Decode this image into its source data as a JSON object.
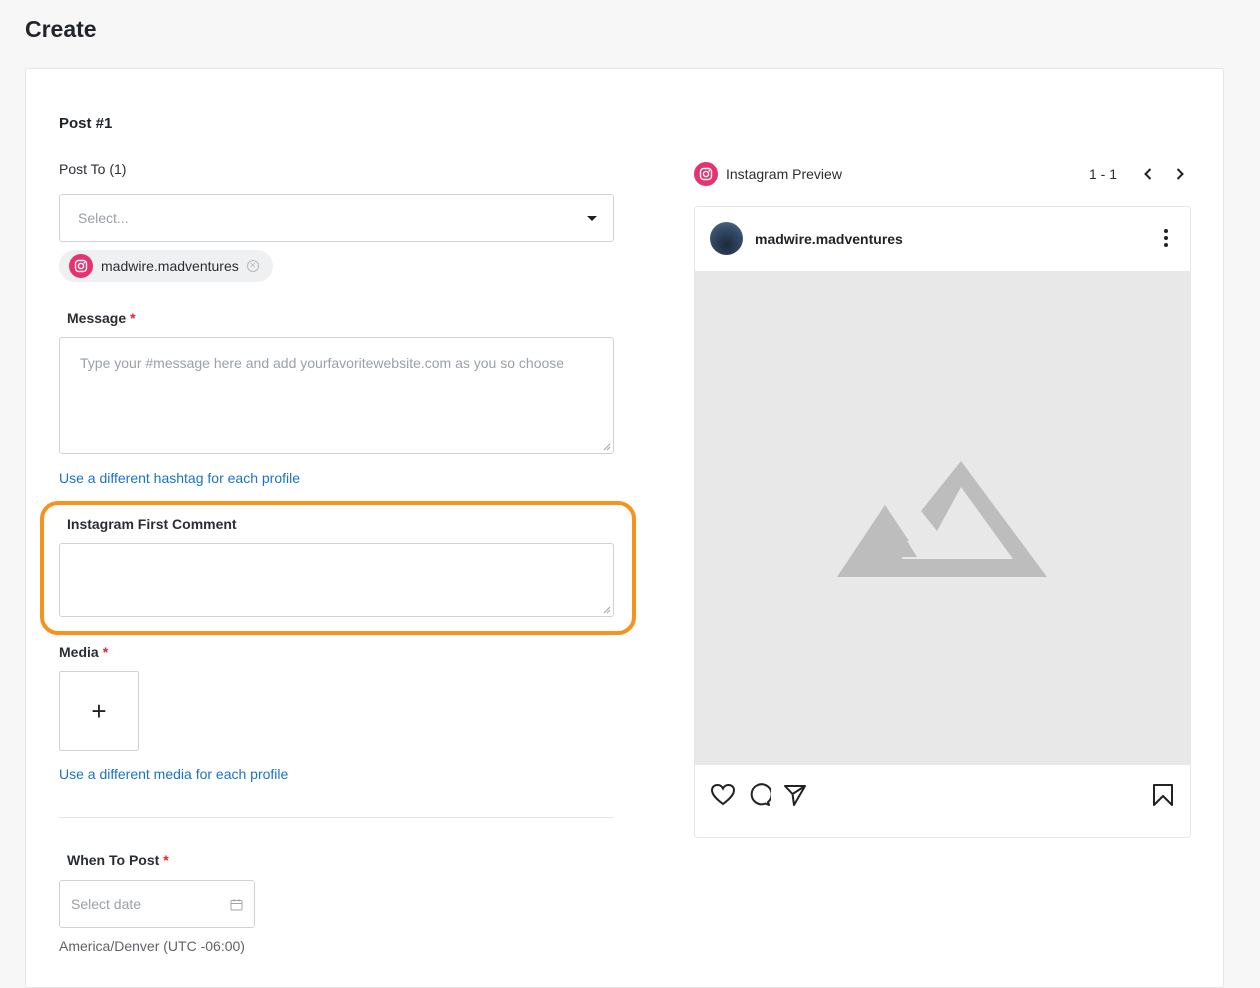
{
  "page": {
    "title": "Create"
  },
  "post": {
    "title": "Post #1",
    "post_to_label": "Post To (1)",
    "select_placeholder": "Select...",
    "selected_profile": "madwire.madventures",
    "message_label": "Message",
    "message_placeholder": "Type your #message here and add yourfavoritewebsite.com as you so choose",
    "hashtag_link": "Use a different hashtag for each profile",
    "first_comment_label": "Instagram First Comment",
    "first_comment_value": "",
    "media_label": "Media",
    "media_add": "+",
    "media_link": "Use a different media for each profile",
    "when_label": "When To Post",
    "date_placeholder": "Select date",
    "timezone": "America/Denver (UTC -06:00)",
    "required_marker": "*"
  },
  "preview": {
    "title": "Instagram Preview",
    "pager": "1 - 1",
    "username": "madwire.madventures"
  },
  "colors": {
    "instagram": "#e4336f",
    "link": "#1a73c8",
    "highlight": "#f7921e",
    "required": "#e0242b"
  },
  "icons": [
    "instagram-icon",
    "caret-down-icon",
    "close-circle-icon",
    "calendar-icon",
    "chevron-left-icon",
    "chevron-right-icon",
    "more-vertical-icon",
    "image-placeholder-icon",
    "heart-icon",
    "comment-icon",
    "send-icon",
    "bookmark-icon"
  ]
}
